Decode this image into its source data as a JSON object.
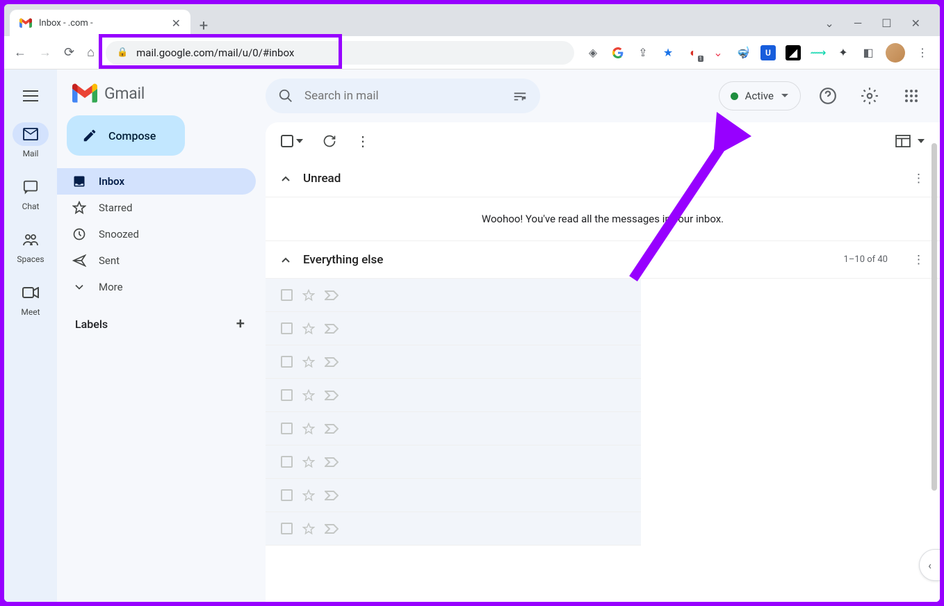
{
  "browser": {
    "tab_title": "Inbox -                          .com -",
    "url": "mail.google.com/mail/u/0/#inbox"
  },
  "rail": [
    {
      "label": "Mail",
      "icon": "mail"
    },
    {
      "label": "Chat",
      "icon": "chat"
    },
    {
      "label": "Spaces",
      "icon": "groups"
    },
    {
      "label": "Meet",
      "icon": "video"
    }
  ],
  "brand": "Gmail",
  "compose": "Compose",
  "folders": [
    {
      "label": "Inbox",
      "icon": "inbox",
      "active": true
    },
    {
      "label": "Starred",
      "icon": "star"
    },
    {
      "label": "Snoozed",
      "icon": "clock"
    },
    {
      "label": "Sent",
      "icon": "send"
    },
    {
      "label": "More",
      "icon": "chevron-down"
    }
  ],
  "labels_header": "Labels",
  "search": {
    "placeholder": "Search in mail"
  },
  "status": {
    "label": "Active"
  },
  "sections": {
    "unread": {
      "title": "Unread",
      "empty": "Woohoo! You've read all the messages in your inbox."
    },
    "other": {
      "title": "Everything else",
      "count": "1–10 of 40",
      "rows": 8
    }
  }
}
